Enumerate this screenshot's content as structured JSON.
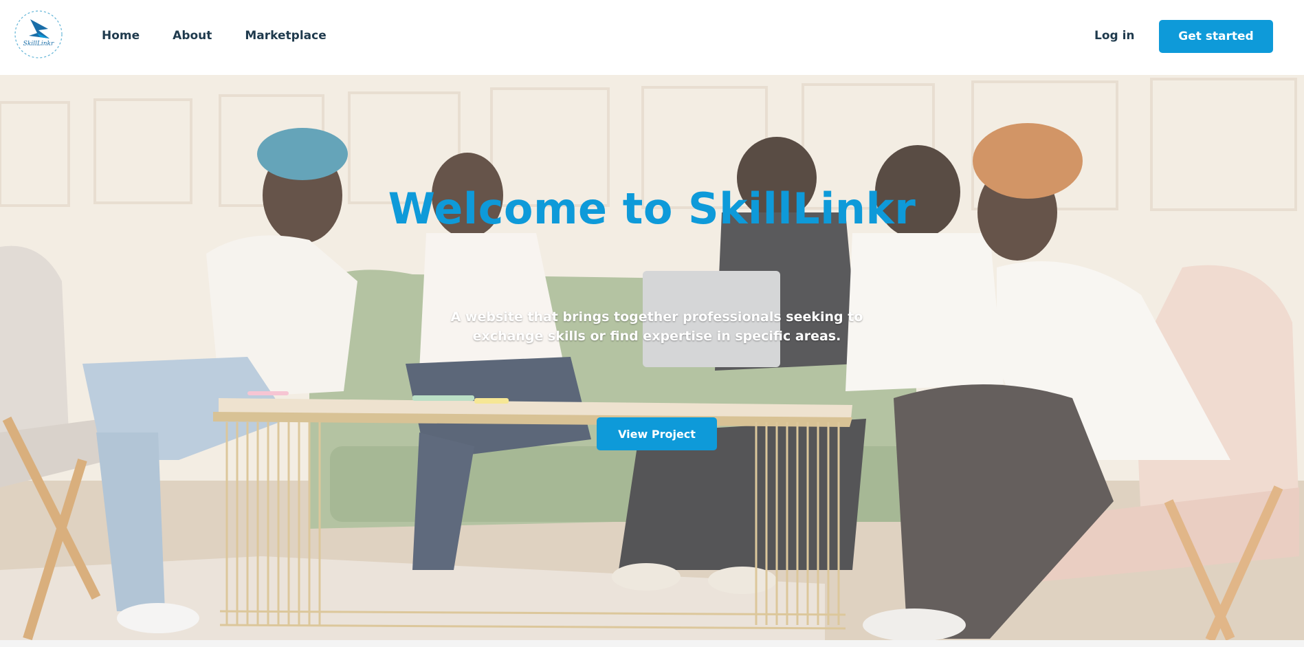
{
  "brand": {
    "logo_icon": "skilllinkr-logo",
    "logo_text": "SkillLinkr",
    "accent": "#0e9ad9"
  },
  "nav": {
    "links": [
      {
        "label": "Home"
      },
      {
        "label": "About"
      },
      {
        "label": "Marketplace"
      }
    ],
    "login_label": "Log in",
    "cta_label": "Get started"
  },
  "hero": {
    "title": "Welcome to SkillLinkr",
    "subtitle": "A website that brings together professionals seeking to exchange skills or find expertise in specific areas.",
    "button_label": "View Project",
    "image_icon": "team-meeting-photo"
  }
}
